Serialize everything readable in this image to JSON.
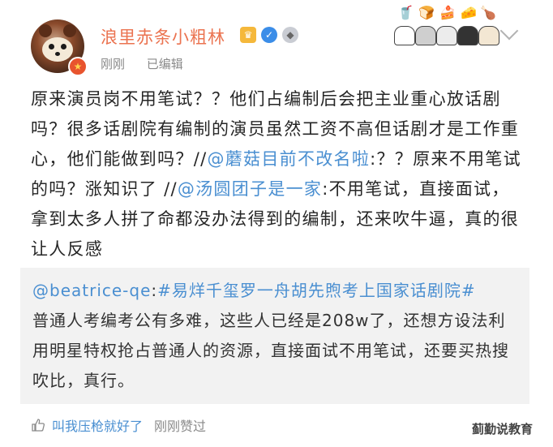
{
  "post": {
    "username": "浪里赤条小粗林",
    "time": "刚刚",
    "edited": "已编辑",
    "text_1": "原来演员岗不用笔试？？他们占编制后会把主业重心放话剧吗？很多话剧院有编制的演员虽然工资不高但话剧才是工作重心，他们能做到吗？//",
    "mention_1": "@蘑菇目前不改名啦",
    "text_2": ":？？原来不用笔试的吗？涨知识了 //",
    "mention_2": "@汤圆团子是一家",
    "text_3": ":不用笔试，直接面试，拿到太多人拼了命都没办法得到的编制，还来吹牛逼，真的很让人反感"
  },
  "repost": {
    "author": "@beatrice-qe",
    "sep": ":",
    "hashtag": "#易烊千玺罗一舟胡先煦考上国家话剧院#",
    "text": "普通人考编考公有多难，这些人已经是208w了，还想方设法利用明星特权抢占普通人的资源，直接面试不用笔试，还要买热搜吹比，真行。"
  },
  "footer": {
    "liker": "叫我压枪就好了",
    "time": "刚刚",
    "action": "赞过"
  },
  "watermark": "蓟勤说教育",
  "colors": {
    "username": "#eb7350",
    "link": "#4a8fd1",
    "meta": "#8a8a8a",
    "repost_bg": "#f2f2f2"
  }
}
